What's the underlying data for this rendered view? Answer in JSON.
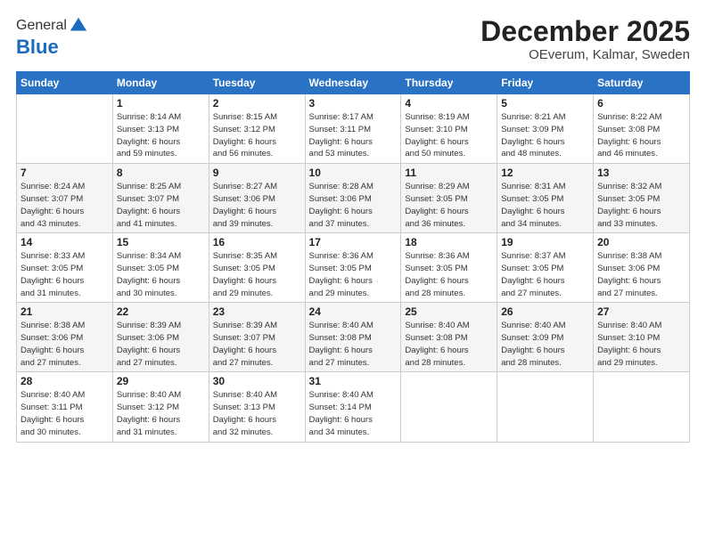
{
  "header": {
    "logo_general": "General",
    "logo_blue": "Blue",
    "month_title": "December 2025",
    "subtitle": "OEverum, Kalmar, Sweden"
  },
  "days_of_week": [
    "Sunday",
    "Monday",
    "Tuesday",
    "Wednesday",
    "Thursday",
    "Friday",
    "Saturday"
  ],
  "weeks": [
    [
      {
        "day": "",
        "info": ""
      },
      {
        "day": "1",
        "info": "Sunrise: 8:14 AM\nSunset: 3:13 PM\nDaylight: 6 hours\nand 59 minutes."
      },
      {
        "day": "2",
        "info": "Sunrise: 8:15 AM\nSunset: 3:12 PM\nDaylight: 6 hours\nand 56 minutes."
      },
      {
        "day": "3",
        "info": "Sunrise: 8:17 AM\nSunset: 3:11 PM\nDaylight: 6 hours\nand 53 minutes."
      },
      {
        "day": "4",
        "info": "Sunrise: 8:19 AM\nSunset: 3:10 PM\nDaylight: 6 hours\nand 50 minutes."
      },
      {
        "day": "5",
        "info": "Sunrise: 8:21 AM\nSunset: 3:09 PM\nDaylight: 6 hours\nand 48 minutes."
      },
      {
        "day": "6",
        "info": "Sunrise: 8:22 AM\nSunset: 3:08 PM\nDaylight: 6 hours\nand 46 minutes."
      }
    ],
    [
      {
        "day": "7",
        "info": "Sunrise: 8:24 AM\nSunset: 3:07 PM\nDaylight: 6 hours\nand 43 minutes."
      },
      {
        "day": "8",
        "info": "Sunrise: 8:25 AM\nSunset: 3:07 PM\nDaylight: 6 hours\nand 41 minutes."
      },
      {
        "day": "9",
        "info": "Sunrise: 8:27 AM\nSunset: 3:06 PM\nDaylight: 6 hours\nand 39 minutes."
      },
      {
        "day": "10",
        "info": "Sunrise: 8:28 AM\nSunset: 3:06 PM\nDaylight: 6 hours\nand 37 minutes."
      },
      {
        "day": "11",
        "info": "Sunrise: 8:29 AM\nSunset: 3:05 PM\nDaylight: 6 hours\nand 36 minutes."
      },
      {
        "day": "12",
        "info": "Sunrise: 8:31 AM\nSunset: 3:05 PM\nDaylight: 6 hours\nand 34 minutes."
      },
      {
        "day": "13",
        "info": "Sunrise: 8:32 AM\nSunset: 3:05 PM\nDaylight: 6 hours\nand 33 minutes."
      }
    ],
    [
      {
        "day": "14",
        "info": "Sunrise: 8:33 AM\nSunset: 3:05 PM\nDaylight: 6 hours\nand 31 minutes."
      },
      {
        "day": "15",
        "info": "Sunrise: 8:34 AM\nSunset: 3:05 PM\nDaylight: 6 hours\nand 30 minutes."
      },
      {
        "day": "16",
        "info": "Sunrise: 8:35 AM\nSunset: 3:05 PM\nDaylight: 6 hours\nand 29 minutes."
      },
      {
        "day": "17",
        "info": "Sunrise: 8:36 AM\nSunset: 3:05 PM\nDaylight: 6 hours\nand 29 minutes."
      },
      {
        "day": "18",
        "info": "Sunrise: 8:36 AM\nSunset: 3:05 PM\nDaylight: 6 hours\nand 28 minutes."
      },
      {
        "day": "19",
        "info": "Sunrise: 8:37 AM\nSunset: 3:05 PM\nDaylight: 6 hours\nand 27 minutes."
      },
      {
        "day": "20",
        "info": "Sunrise: 8:38 AM\nSunset: 3:06 PM\nDaylight: 6 hours\nand 27 minutes."
      }
    ],
    [
      {
        "day": "21",
        "info": "Sunrise: 8:38 AM\nSunset: 3:06 PM\nDaylight: 6 hours\nand 27 minutes."
      },
      {
        "day": "22",
        "info": "Sunrise: 8:39 AM\nSunset: 3:06 PM\nDaylight: 6 hours\nand 27 minutes."
      },
      {
        "day": "23",
        "info": "Sunrise: 8:39 AM\nSunset: 3:07 PM\nDaylight: 6 hours\nand 27 minutes."
      },
      {
        "day": "24",
        "info": "Sunrise: 8:40 AM\nSunset: 3:08 PM\nDaylight: 6 hours\nand 27 minutes."
      },
      {
        "day": "25",
        "info": "Sunrise: 8:40 AM\nSunset: 3:08 PM\nDaylight: 6 hours\nand 28 minutes."
      },
      {
        "day": "26",
        "info": "Sunrise: 8:40 AM\nSunset: 3:09 PM\nDaylight: 6 hours\nand 28 minutes."
      },
      {
        "day": "27",
        "info": "Sunrise: 8:40 AM\nSunset: 3:10 PM\nDaylight: 6 hours\nand 29 minutes."
      }
    ],
    [
      {
        "day": "28",
        "info": "Sunrise: 8:40 AM\nSunset: 3:11 PM\nDaylight: 6 hours\nand 30 minutes."
      },
      {
        "day": "29",
        "info": "Sunrise: 8:40 AM\nSunset: 3:12 PM\nDaylight: 6 hours\nand 31 minutes."
      },
      {
        "day": "30",
        "info": "Sunrise: 8:40 AM\nSunset: 3:13 PM\nDaylight: 6 hours\nand 32 minutes."
      },
      {
        "day": "31",
        "info": "Sunrise: 8:40 AM\nSunset: 3:14 PM\nDaylight: 6 hours\nand 34 minutes."
      },
      {
        "day": "",
        "info": ""
      },
      {
        "day": "",
        "info": ""
      },
      {
        "day": "",
        "info": ""
      }
    ]
  ]
}
